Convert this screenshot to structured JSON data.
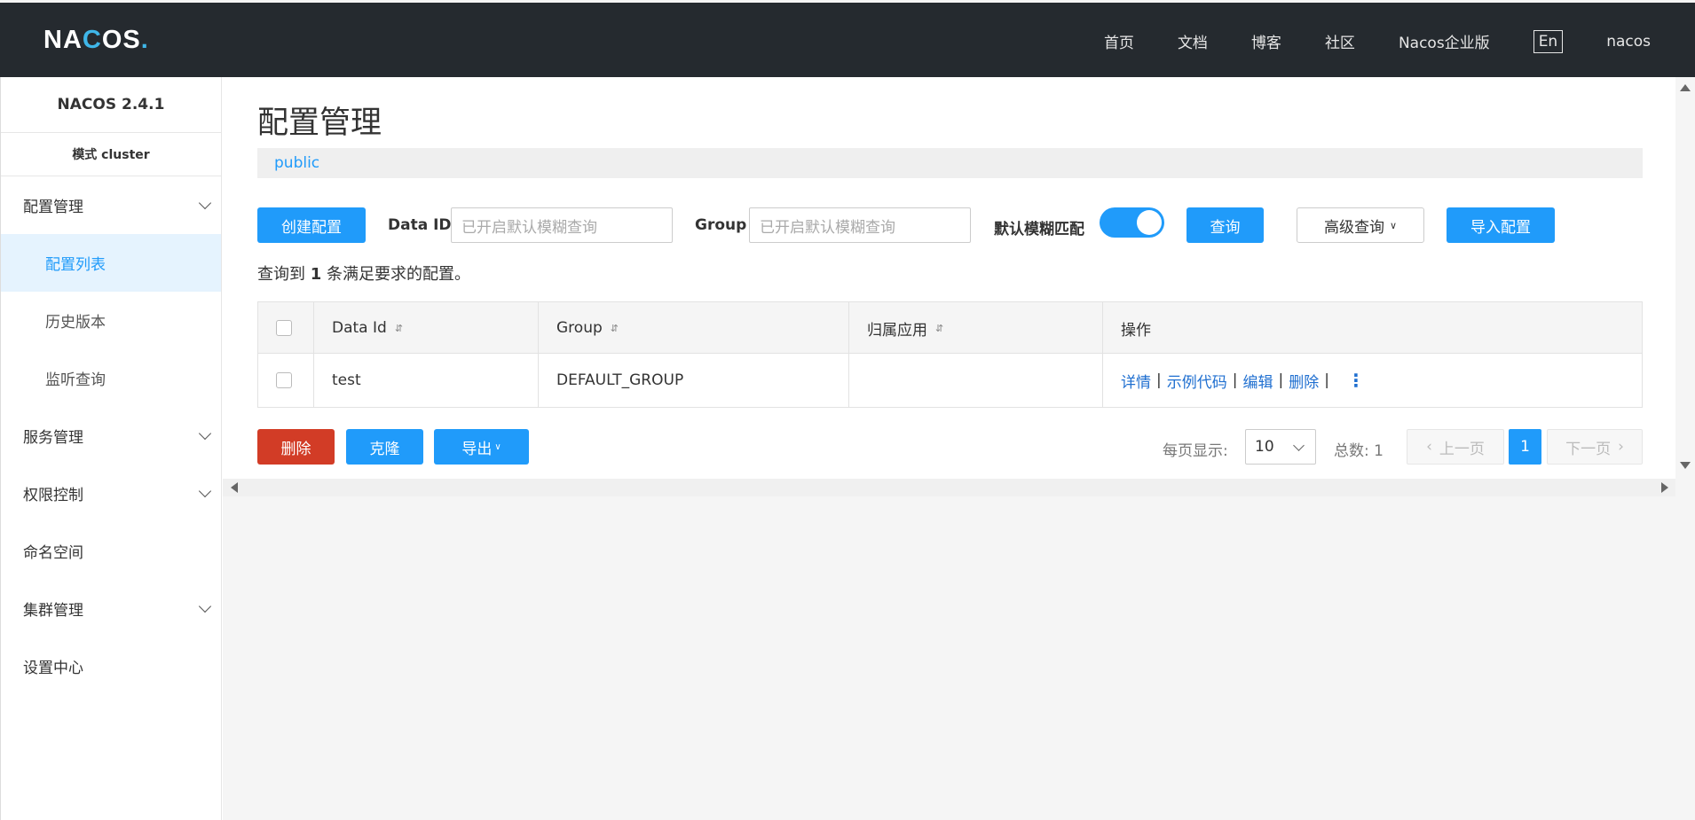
{
  "header": {
    "logo": {
      "prefix": "NA",
      "c": "C",
      "suffix": "OS",
      "dot": "."
    },
    "nav": [
      "首页",
      "文档",
      "博客",
      "社区",
      "Nacos企业版"
    ],
    "lang": "En",
    "user": "nacos"
  },
  "sidebar": {
    "version": "NACOS 2.4.1",
    "mode": "模式 cluster",
    "items": [
      {
        "label": "配置管理",
        "expandable": true
      },
      {
        "label": "配置列表",
        "sub": true,
        "active": true
      },
      {
        "label": "历史版本",
        "sub": true
      },
      {
        "label": "监听查询",
        "sub": true
      },
      {
        "label": "服务管理",
        "expandable": true
      },
      {
        "label": "权限控制",
        "expandable": true
      },
      {
        "label": "命名空间",
        "expandable": false
      },
      {
        "label": "集群管理",
        "expandable": true
      },
      {
        "label": "设置中心",
        "expandable": false
      }
    ]
  },
  "main": {
    "title": "配置管理",
    "namespace": "public",
    "toolbar": {
      "create_label": "创建配置",
      "dataid_label": "Data ID",
      "dataid_placeholder": "已开启默认模糊查询",
      "group_label": "Group",
      "group_placeholder": "已开启默认模糊查询",
      "fuzzy_label": "默认模糊匹配",
      "fuzzy_on": true,
      "query_label": "查询",
      "advanced_label": "高级查询",
      "import_label": "导入配置"
    },
    "result": {
      "prefix": "查询到 ",
      "count": "1",
      "suffix": " 条满足要求的配置。"
    },
    "table": {
      "columns": [
        "Data Id",
        "Group",
        "归属应用",
        "操作"
      ],
      "rows": [
        {
          "data_id": "test",
          "group": "DEFAULT_GROUP",
          "app": "",
          "ops": [
            "详情",
            "示例代码",
            "编辑",
            "删除"
          ],
          "more": "⋮"
        }
      ]
    },
    "bottom": {
      "delete_label": "删除",
      "clone_label": "克隆",
      "export_label": "导出"
    },
    "pagination": {
      "per_page_label": "每页显示:",
      "per_page_value": "10",
      "total_label": "总数: 1",
      "prev_label": "上一页",
      "current": "1",
      "next_label": "下一页"
    }
  }
}
